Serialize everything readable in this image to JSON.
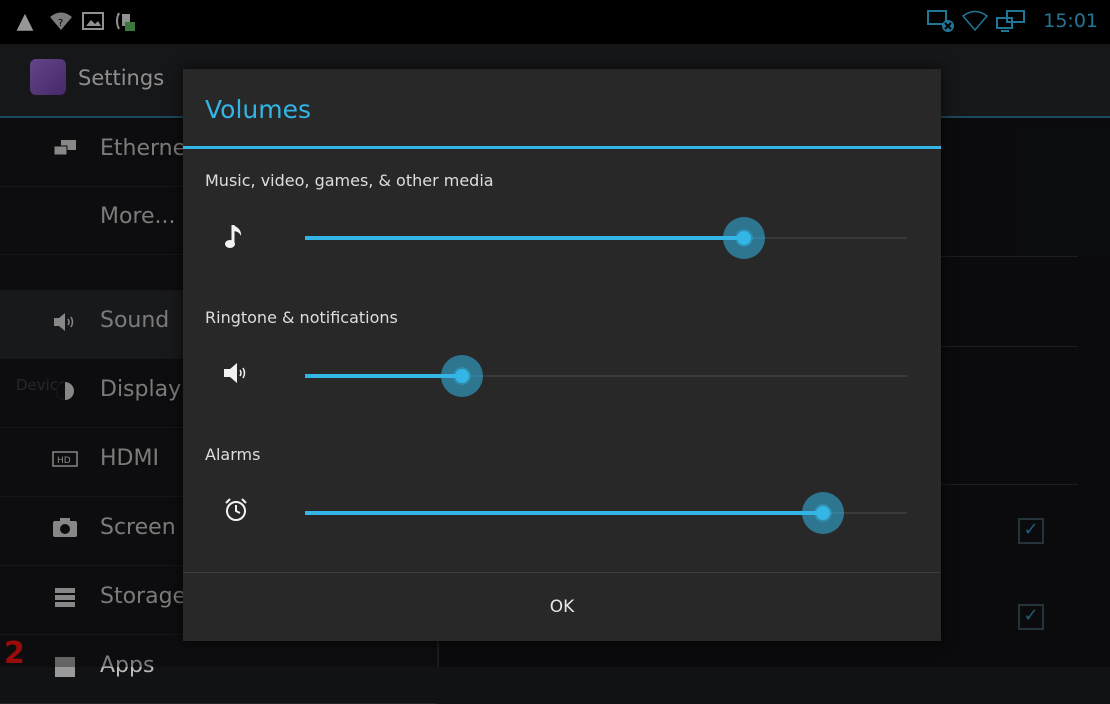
{
  "status_bar": {
    "time": "15:01",
    "left_icons": [
      "warning-icon",
      "wifi-question-icon",
      "image-icon",
      "usb-debug-icon"
    ],
    "right_icons": [
      "ethernet-disconnected-icon",
      "wifi-empty-icon",
      "monitor-network-icon"
    ]
  },
  "action_bar": {
    "title": "Settings"
  },
  "settings_list": {
    "items": [
      {
        "label": "Etherne",
        "icon": "ethernet-icon"
      },
      {
        "label": "More...",
        "icon": ""
      },
      {
        "label": "Sound",
        "icon": "speaker-icon"
      },
      {
        "label": "Display",
        "icon": "brightness-icon"
      },
      {
        "label": "HDMI",
        "icon": "hdmi-icon"
      },
      {
        "label": "Screen",
        "icon": "camera-icon"
      },
      {
        "label": "Storage",
        "icon": "storage-icon"
      },
      {
        "label": "Apps",
        "icon": "apps-icon"
      }
    ],
    "category": "Device"
  },
  "annotation": "2",
  "dialog": {
    "title": "Volumes",
    "ok_label": "OK",
    "sliders": [
      {
        "label": "Music, video, games, & other media",
        "icon": "music-note-icon",
        "value": 0.73
      },
      {
        "label": "Ringtone & notifications",
        "icon": "speaker-icon",
        "value": 0.26
      },
      {
        "label": "Alarms",
        "icon": "alarm-clock-icon",
        "value": 0.86
      }
    ]
  },
  "colors": {
    "accent": "#33b5e5",
    "dialog_bg": "#282828",
    "background": "#111214"
  }
}
